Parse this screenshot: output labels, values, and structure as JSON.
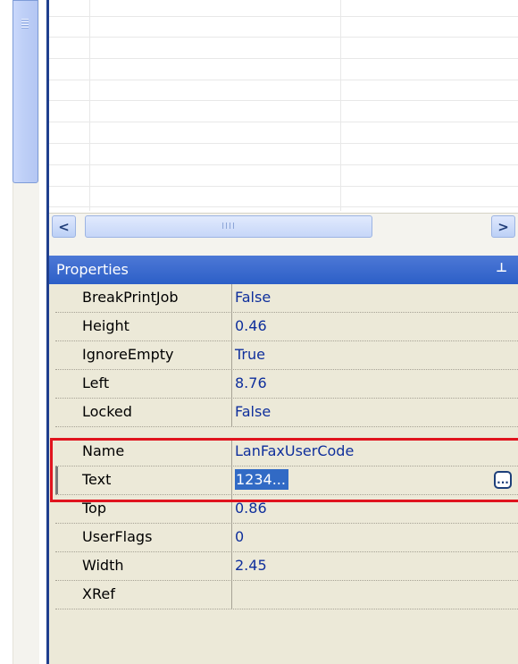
{
  "scroll": {
    "left_label": "<",
    "right_label": ">",
    "thumb_grip": "IIII"
  },
  "properties_panel": {
    "title": "Properties",
    "pin_icon": "pin-icon",
    "rows": [
      {
        "name": "BreakPrintJob",
        "value": "False"
      },
      {
        "name": "Height",
        "value": "0.46"
      },
      {
        "name": "IgnoreEmpty",
        "value": "True"
      },
      {
        "name": "Left",
        "value": "8.76"
      },
      {
        "name": "Locked",
        "value": "False"
      },
      {
        "name": "Name",
        "value": "LanFaxUserCode"
      },
      {
        "name": "Text",
        "value": "1234...",
        "editor_button": "..."
      },
      {
        "name": "Top",
        "value": "0.86"
      },
      {
        "name": "UserFlags",
        "value": "0"
      },
      {
        "name": "Width",
        "value": "2.45"
      },
      {
        "name": "XRef",
        "value": ""
      }
    ]
  },
  "colors": {
    "header_blue": "#2c5fc7",
    "value_text": "#0f2f9c",
    "selection": "#316ac5",
    "highlight": "#e0141e",
    "panel_bg": "#ece9d8"
  }
}
